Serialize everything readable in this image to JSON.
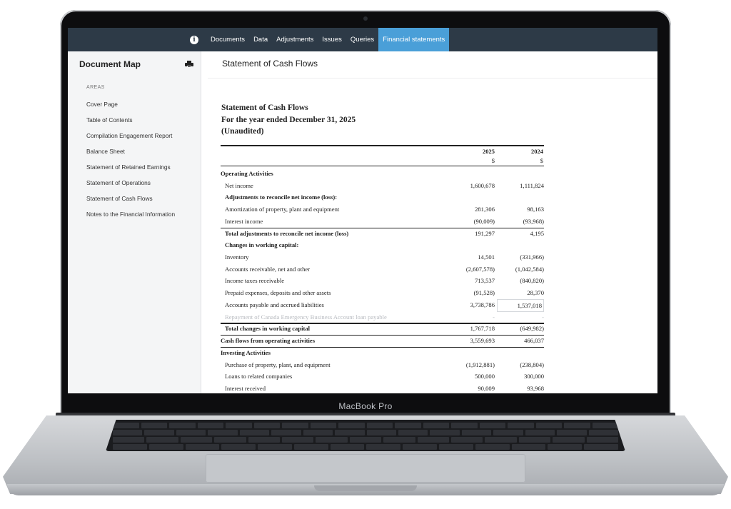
{
  "device_label": "MacBook Pro",
  "topnav": {
    "items": [
      {
        "label": "Documents",
        "active": false
      },
      {
        "label": "Data",
        "active": false
      },
      {
        "label": "Adjustments",
        "active": false
      },
      {
        "label": "Issues",
        "active": false
      },
      {
        "label": "Queries",
        "active": false
      },
      {
        "label": "Financial statements",
        "active": true
      }
    ],
    "bar_color": "#2d3a47",
    "active_color": "#4a9fd8"
  },
  "sidebar": {
    "title": "Document Map",
    "areas_label": "AREAS",
    "items": [
      "Cover Page",
      "Table of Contents",
      "Compilation Engagement Report",
      "Balance Sheet",
      "Statement of Retained Earnings",
      "Statement of Operations",
      "Statement of Cash Flows",
      "Notes to the Financial Information"
    ]
  },
  "main": {
    "page_title": "Statement of Cash Flows",
    "statement": {
      "title": "Statement of Cash Flows",
      "period": "For the year ended December 31, 2025",
      "audit_status": "(Unaudited)",
      "columns": [
        {
          "year": "2025",
          "currency": "$"
        },
        {
          "year": "2024",
          "currency": "$"
        }
      ],
      "rows": [
        {
          "label": "Operating Activities",
          "type": "section",
          "v2025": "",
          "v2024": ""
        },
        {
          "label": "Net income",
          "type": "item",
          "v2025": "1,600,678",
          "v2024": "1,111,824"
        },
        {
          "label": "Adjustments to reconcile net income (loss):",
          "type": "subhead",
          "v2025": "",
          "v2024": ""
        },
        {
          "label": "Amortization of property, plant and equipment",
          "type": "item",
          "v2025": "281,306",
          "v2024": "98,163"
        },
        {
          "label": "Interest income",
          "type": "item",
          "v2025": "(90,009)",
          "v2024": "(93,968)"
        },
        {
          "label": "Total adjustments to reconcile net income (loss)",
          "type": "total",
          "v2025": "191,297",
          "v2024": "4,195"
        },
        {
          "label": "Changes in working capital:",
          "type": "subhead",
          "v2025": "",
          "v2024": ""
        },
        {
          "label": "Inventory",
          "type": "item",
          "v2025": "14,501",
          "v2024": "(331,966)"
        },
        {
          "label": "Accounts receivable, net and other",
          "type": "item",
          "v2025": "(2,607,578)",
          "v2024": "(1,042,584)"
        },
        {
          "label": "Income taxes receivable",
          "type": "item",
          "v2025": "713,537",
          "v2024": "(840,820)"
        },
        {
          "label": "Prepaid expenses, deposits and other assets",
          "type": "item",
          "v2025": "(91,528)",
          "v2024": "28,370"
        },
        {
          "label": "Accounts payable and accrued liabilities",
          "type": "item",
          "v2025": "3,738,786",
          "v2024": "1,537,018"
        },
        {
          "label": "Repayment of Canada Emergency Business Account loan payable",
          "type": "faded",
          "v2025": "-",
          "v2024": "-"
        },
        {
          "label": "Total changes in working capital",
          "type": "total",
          "v2025": "1,767,718",
          "v2024": "(649,982)"
        },
        {
          "label": "Cash flows from operating activities",
          "type": "total-flush",
          "v2025": "3,559,693",
          "v2024": "466,037"
        },
        {
          "label": "Investing Activities",
          "type": "section",
          "v2025": "",
          "v2024": ""
        },
        {
          "label": "Purchase of property, plant, and equipment",
          "type": "item",
          "v2025": "(1,912,881)",
          "v2024": "(238,804)"
        },
        {
          "label": "Loans to related companies",
          "type": "item",
          "v2025": "500,000",
          "v2024": "300,000"
        },
        {
          "label": "Interest received",
          "type": "item",
          "v2025": "90,009",
          "v2024": "93,968"
        }
      ]
    }
  }
}
